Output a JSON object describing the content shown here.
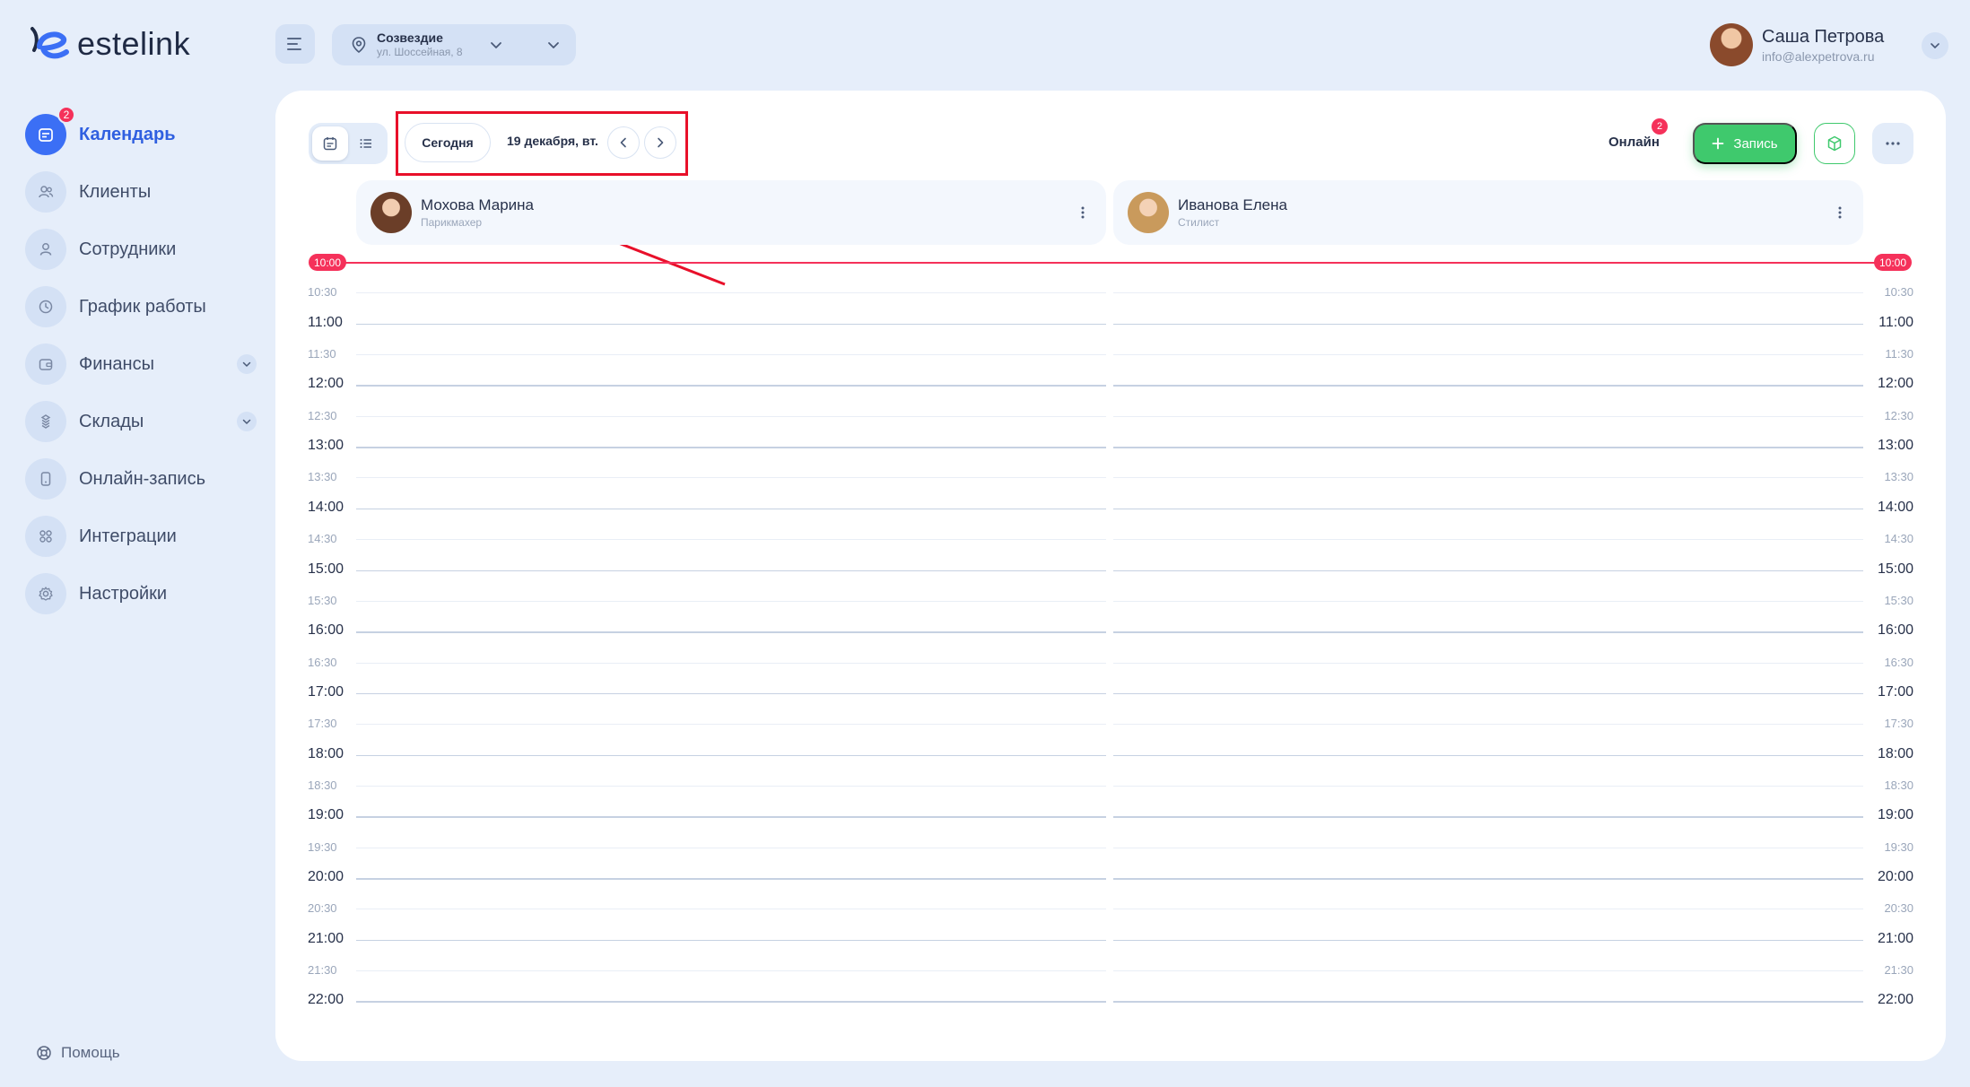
{
  "brand": {
    "name": "estelink"
  },
  "location": {
    "name": "Созвездие",
    "address": "ул. Шоссейная, 8"
  },
  "user": {
    "name": "Саша Петрова",
    "email": "info@alexpetrova.ru"
  },
  "sidebar": {
    "items": [
      {
        "label": "Календарь",
        "icon": "calendar-icon",
        "badge": "2",
        "active": true
      },
      {
        "label": "Клиенты",
        "icon": "clients-icon"
      },
      {
        "label": "Сотрудники",
        "icon": "user-icon"
      },
      {
        "label": "График работы",
        "icon": "clock-icon"
      },
      {
        "label": "Финансы",
        "icon": "wallet-icon",
        "expandable": true
      },
      {
        "label": "Склады",
        "icon": "boxes-icon",
        "expandable": true
      },
      {
        "label": "Онлайн-запись",
        "icon": "phone-icon"
      },
      {
        "label": "Интеграции",
        "icon": "grid-icon"
      },
      {
        "label": "Настройки",
        "icon": "gear-icon"
      }
    ],
    "help_label": "Помощь"
  },
  "toolbar": {
    "today_label": "Сегодня",
    "date_label": "19 декабря, вт.",
    "online_label": "Онлайн",
    "online_badge": "2",
    "add_label": "Запись"
  },
  "staff": [
    {
      "name": "Мохова Марина",
      "role": "Парикмахер"
    },
    {
      "name": "Иванова Елена",
      "role": "Стилист"
    }
  ],
  "timeline": {
    "current_time": "10:00",
    "slots": [
      "10:00",
      "10:30",
      "11:00",
      "11:30",
      "12:00",
      "12:30",
      "13:00",
      "13:30",
      "14:00",
      "14:30",
      "15:00",
      "15:30",
      "16:00",
      "16:30",
      "17:00",
      "17:30",
      "18:00",
      "18:30",
      "19:00",
      "19:30",
      "20:00",
      "20:30",
      "21:00",
      "21:30",
      "22:00"
    ]
  },
  "colors": {
    "accent": "#3b6ff5",
    "green": "#3fc96d",
    "red": "#f5315a",
    "background": "#e6eefa"
  }
}
